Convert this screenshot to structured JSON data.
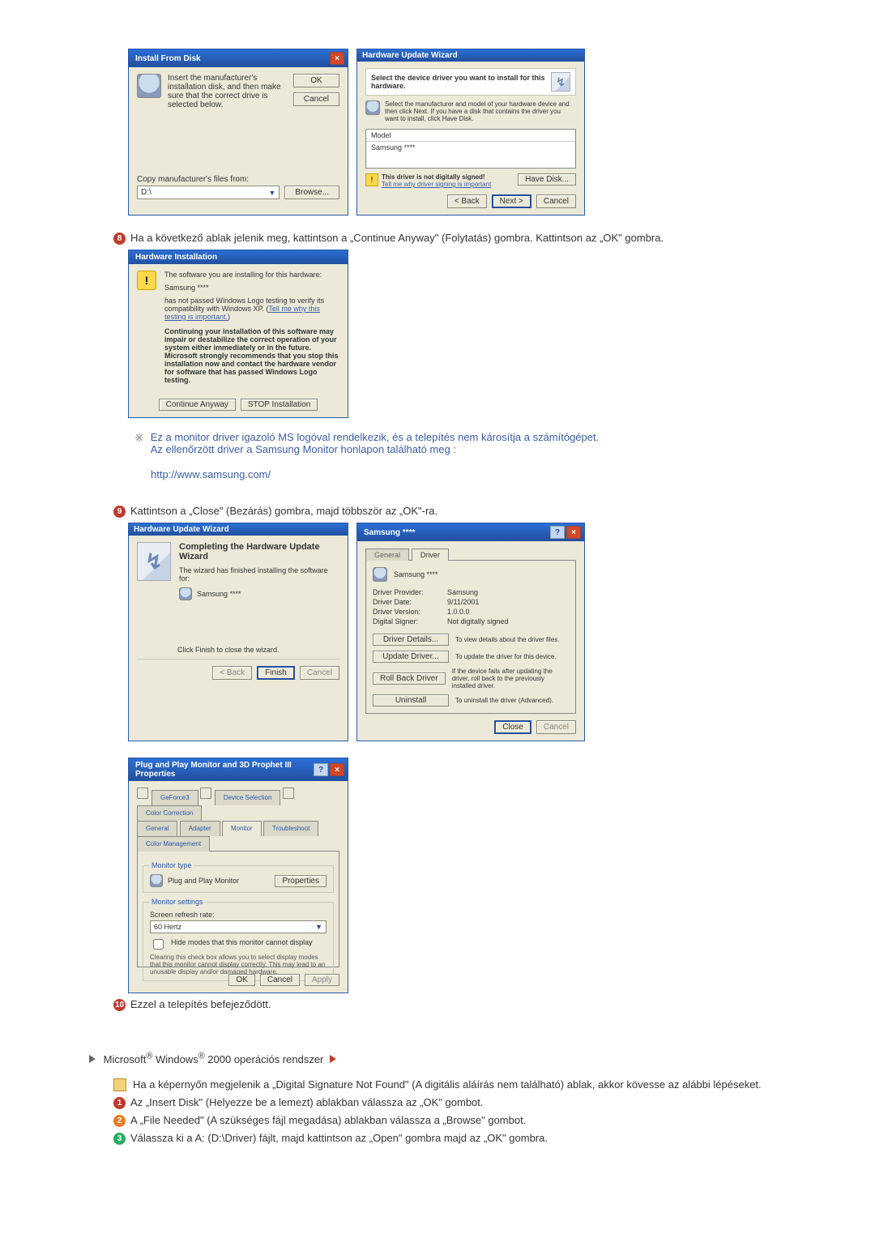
{
  "install_disk": {
    "title": "Install From Disk",
    "instruction": "Insert the manufacturer's installation disk, and then make sure that the correct drive is selected below.",
    "ok": "OK",
    "cancel": "Cancel",
    "copy_label": "Copy manufacturer's files from:",
    "path": "D:\\",
    "browse": "Browse..."
  },
  "hw_update": {
    "title": "Hardware Update Wizard",
    "heading": "Select the device driver you want to install for this hardware.",
    "desc": "Select the manufacturer and model of your hardware device and then click Next. If you have a disk that contains the driver you want to install, click Have Disk.",
    "model_label": "Model",
    "model_value": "Samsung ****",
    "warn": "This driver is not digitally signed!",
    "tellme": "Tell me why driver signing is important",
    "have_disk": "Have Disk...",
    "back": "< Back",
    "next": "Next >",
    "cancel": "Cancel"
  },
  "step8": "Ha a következő ablak jelenik meg, kattintson a „Continue Anyway\" (Folytatás) gombra. Kattintson az „OK\" gombra.",
  "hw_install": {
    "title": "Hardware Installation",
    "line1": "The software you are installing for this hardware:",
    "line2": "Samsung ****",
    "line3": "has not passed Windows Logo testing to verify its compatibility with Windows XP. (",
    "link": "Tell me why this testing is important.",
    "bold": "Continuing your installation of this software may impair or destabilize the correct operation of your system either immediately or in the future. Microsoft strongly recommends that you stop this installation now and contact the hardware vendor for software that has passed Windows Logo testing.",
    "continue": "Continue Anyway",
    "stop": "STOP Installation"
  },
  "note_block": {
    "line1": "Ez a monitor driver igazoló MS logóval rendelkezik, és a telepítés nem károsítja a számítógépet.",
    "line2": "Az ellenőrzött driver a Samsung Monitor honlapon található meg :",
    "url": "http://www.samsung.com/"
  },
  "step9": "Kattintson a „Close\" (Bezárás) gombra, majd többször az „OK\"-ra.",
  "complete_wizard": {
    "title": "Hardware Update Wizard",
    "heading": "Completing the Hardware Update Wizard",
    "line1": "The wizard has finished installing the software for:",
    "device": "Samsung ****",
    "finish_hint": "Click Finish to close the wizard.",
    "back": "< Back",
    "finish": "Finish",
    "cancel": "Cancel"
  },
  "driver_props": {
    "title": "Samsung ****",
    "tab_general": "General",
    "tab_driver": "Driver",
    "device": "Samsung ****",
    "provider_l": "Driver Provider:",
    "provider_v": "Samsung",
    "date_l": "Driver Date:",
    "date_v": "9/11/2001",
    "version_l": "Driver Version:",
    "version_v": "1.0.0.0",
    "signer_l": "Digital Signer:",
    "signer_v": "Not digitally signed",
    "b_details": "Driver Details...",
    "b_details_d": "To view details about the driver files.",
    "b_update": "Update Driver...",
    "b_update_d": "To update the driver for this device.",
    "b_rollback": "Roll Back Driver",
    "b_rollback_d": "If the device fails after updating the driver, roll back to the previously installed driver.",
    "b_uninstall": "Uninstall",
    "b_uninstall_d": "To uninstall the driver (Advanced).",
    "close": "Close",
    "cancel": "Cancel"
  },
  "monitor_props": {
    "title": "Plug and Play Monitor and 3D Prophet III Properties",
    "tabs": [
      "GeForce3",
      "Device Selection",
      "Color Correction",
      "General",
      "Adapter",
      "Monitor",
      "Troubleshoot",
      "Color Management"
    ],
    "type_legend": "Monitor type",
    "type_name": "Plug and Play Monitor",
    "properties": "Properties",
    "settings_legend": "Monitor settings",
    "refresh_l": "Screen refresh rate:",
    "refresh_v": "60 Hertz",
    "hide_modes": "Hide modes that this monitor cannot display",
    "hide_desc": "Clearing this check box allows you to select display modes that this monitor cannot display correctly. This may lead to an unusable display and/or damaged hardware.",
    "ok": "OK",
    "cancel": "Cancel",
    "apply": "Apply"
  },
  "step10": "Ezzel a telepítés befejeződött.",
  "win2000_header": "Microsoft® Windows® 2000 operációs rendszer",
  "win2000_intro": "Ha a képernyőn megjelenik a „Digital Signature Not Found\" (A digitális aláírás nem található) ablak, akkor kövesse az alábbi lépéseket.",
  "w2k_step1": "Az „Insert Disk\" (Helyezze be a lemezt) ablakban válassza az „OK\" gombot.",
  "w2k_step2": "A „File Needed\" (A szükséges fájl megadása) ablakban válassza a „Browse\" gombot.",
  "w2k_step3": "Válassza ki a A: (D:\\Driver) fájlt, majd kattintson az „Open\" gombra majd az „OK\" gombra."
}
